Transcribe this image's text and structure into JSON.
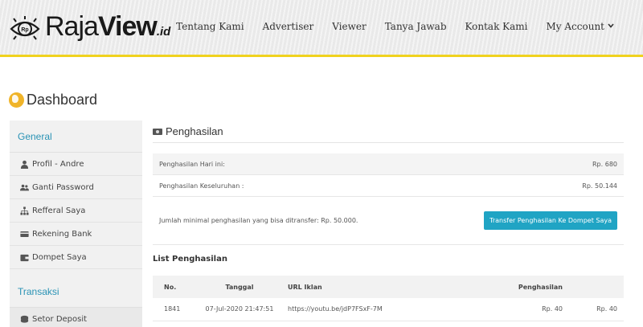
{
  "header": {
    "logo": {
      "main": "Raja",
      "bold": "View",
      "domain": ".id"
    },
    "nav": [
      {
        "label": "Tentang Kami"
      },
      {
        "label": "Advertiser"
      },
      {
        "label": "Viewer"
      },
      {
        "label": "Tanya Jawab"
      },
      {
        "label": "Kontak Kami"
      },
      {
        "label": "My Account"
      }
    ],
    "accent_color": "#f0d21e"
  },
  "page": {
    "title": "Dashboard"
  },
  "sidebar": {
    "general_heading": "General",
    "general_items": [
      {
        "label": "Profil - Andre",
        "icon": "user-icon"
      },
      {
        "label": "Ganti Password",
        "icon": "users-icon"
      },
      {
        "label": "Refferal Saya",
        "icon": "sitemap-icon"
      },
      {
        "label": "Rekening Bank",
        "icon": "credit-card-icon"
      },
      {
        "label": "Dompet Saya",
        "icon": "wallet-icon"
      }
    ],
    "transaksi_heading": "Transaksi",
    "transaksi_items": [
      {
        "label": "Setor Deposit",
        "icon": "coins-icon"
      }
    ],
    "heading_color": "#2a93b5"
  },
  "main": {
    "section_title": "Penghasilan",
    "today_label": "Penghasilan Hari ini:",
    "today_value": "Rp. 680",
    "total_label": "Penghasilan Keseluruhan :",
    "total_value": "Rp. 50.144",
    "min_note": "Jumlah minimal penghasilan yang bisa ditransfer: Rp. 50.000.",
    "transfer_button": "Transfer Penghasilan Ke Dompet Saya",
    "button_color": "#20a4c4",
    "list_title": "List Penghasilan",
    "columns": {
      "no": "No.",
      "tanggal": "Tanggal",
      "url": "URL Iklan",
      "penghasilan": "Penghasilan"
    },
    "rows": [
      {
        "no": "1841",
        "tanggal": "07-Jul-2020 21:47:51",
        "url": "https://youtu.be/jdP7FSxF-7M",
        "p1": "Rp. 40",
        "p2": "Rp. 40"
      }
    ]
  }
}
